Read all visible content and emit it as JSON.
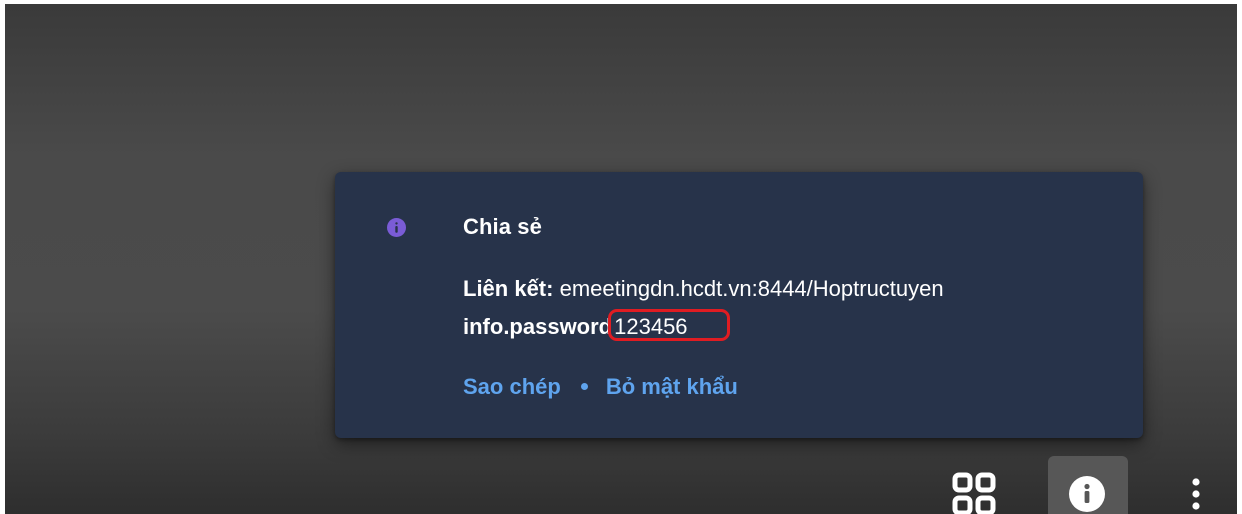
{
  "popup": {
    "title": "Chia sẻ",
    "link_label": "Liên kết:",
    "link_value": "emeetingdn.hcdt.vn:8444/Hoptructuyen",
    "password_label": "info.password",
    "password_value": "123456",
    "copy_label": "Sao chép",
    "remove_password_label": "Bỏ mật khẩu"
  },
  "icons": {
    "popup_icon": "info-icon",
    "toolbar": [
      "grid-view-icon",
      "info-icon",
      "more-vert-icon"
    ]
  },
  "colors": {
    "popup_background": "#27334a",
    "info_accent": "#7a5cd6",
    "link_accent": "#5fa4ee",
    "annotation_red": "#e01c22"
  }
}
